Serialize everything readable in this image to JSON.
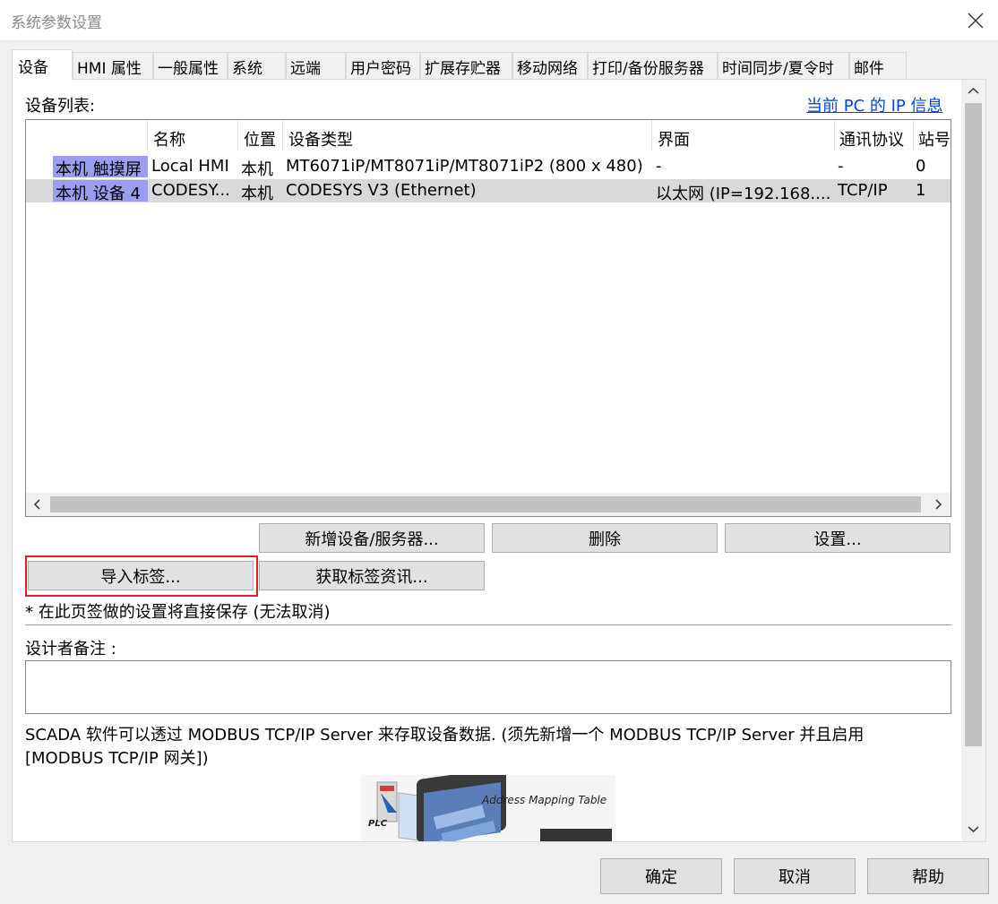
{
  "window": {
    "title": "系统参数设置"
  },
  "tabs": [
    "设备",
    "HMI 属性",
    "一般属性",
    "系统",
    "远端",
    "用户密码",
    "扩展存贮器",
    "移动网络",
    "打印/备份服务器",
    "时间同步/夏令时",
    "邮件"
  ],
  "device_list": {
    "label": "设备列表:",
    "pc_ip_link": "当前 PC 的 IP 信息",
    "columns": [
      "名称",
      "位置",
      "设备类型",
      "界面",
      "通讯协议",
      "站号"
    ],
    "rows": [
      {
        "group": "本机 触摸屏",
        "name": "Local HMI",
        "location": "本机",
        "type": "MT6071iP/MT8071iP/MT8071iP2 (800 x 480)",
        "interface": "-",
        "protocol": "-",
        "station": "0"
      },
      {
        "group": "本机 设备 4",
        "name": "CODESY...",
        "location": "本机",
        "type": "CODESYS V3 (Ethernet)",
        "interface": "以太网 (IP=192.168....",
        "protocol": "TCP/IP",
        "station": "1"
      }
    ]
  },
  "buttons": {
    "add_device": "新增设备/服务器...",
    "delete": "删除",
    "settings": "设置...",
    "import_tags": "导入标签...",
    "get_tag_info": "获取标签资讯..."
  },
  "note_save": "* 在此页签做的设置将直接保存 (无法取消)",
  "designer_notes": {
    "label": "设计者备注 :",
    "value": ""
  },
  "scada_text": {
    "line1": "SCADA 软件可以透过 MODBUS TCP/IP Server 来存取设备数据. (须先新增一个 MODBUS TCP/IP Server 并且启用",
    "line2": "[MODBUS TCP/IP 网关])"
  },
  "illustration": {
    "caption": "Address Mapping Table",
    "plc_label": "PLC"
  },
  "footer": {
    "ok": "确定",
    "cancel": "取消",
    "help": "帮助"
  },
  "colors": {
    "highlight": "#9b9ef0",
    "link": "#0645d8",
    "red_box": "#e02020",
    "selected_row": "#d9d9d9"
  }
}
